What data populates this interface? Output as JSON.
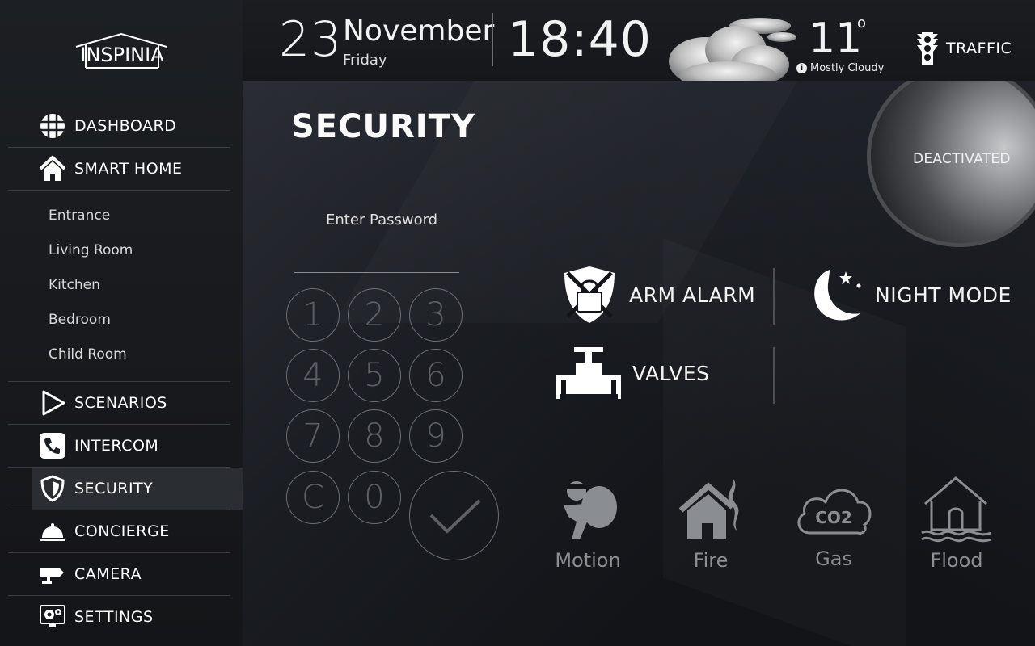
{
  "sidebar": {
    "logo_text": "INSPINIA",
    "items": [
      {
        "label": "DASHBOARD",
        "icon": "grid-globe-icon"
      },
      {
        "label": "SMART HOME",
        "icon": "home-icon"
      },
      {
        "label": "SCENARIOS",
        "icon": "play-icon"
      },
      {
        "label": "INTERCOM",
        "icon": "phone-icon"
      },
      {
        "label": "SECURITY",
        "icon": "shield-icon",
        "active": true
      },
      {
        "label": "CONCIERGE",
        "icon": "service-bell-icon"
      },
      {
        "label": "CAMERA",
        "icon": "camera-icon"
      },
      {
        "label": "SETTINGS",
        "icon": "settings-gears-icon"
      }
    ],
    "rooms": [
      "Entrance",
      "Living Room",
      "Kitchen",
      "Bedroom",
      "Child Room"
    ]
  },
  "header": {
    "day": "23",
    "month": "November",
    "weekday": "Friday",
    "time": "18:40",
    "temperature": "11",
    "degree_symbol": "o",
    "condition": "Mostly Cloudy",
    "traffic_label": "TRAFFIC"
  },
  "security": {
    "title": "SECURITY",
    "password_label": "Enter Password",
    "keys": [
      "1",
      "2",
      "3",
      "4",
      "5",
      "6",
      "7",
      "8",
      "9",
      "C",
      "0"
    ],
    "status": "DEACTIVATED",
    "actions": {
      "arm_alarm": "ARM ALARM",
      "night_mode": "NIGHT MODE",
      "valves": "VALVES"
    },
    "sensors": [
      {
        "label": "Motion",
        "icon": "burglar-icon"
      },
      {
        "label": "Fire",
        "icon": "house-fire-icon"
      },
      {
        "label": "Gas",
        "icon": "co2-cloud-icon"
      },
      {
        "label": "Flood",
        "icon": "house-flood-icon"
      }
    ]
  },
  "colors": {
    "sidebar_bg": "#1c1f23",
    "active_bg": "#2a2d31",
    "keypad_stroke": "#6b6e73",
    "sensor_gray": "#8a8d92"
  }
}
